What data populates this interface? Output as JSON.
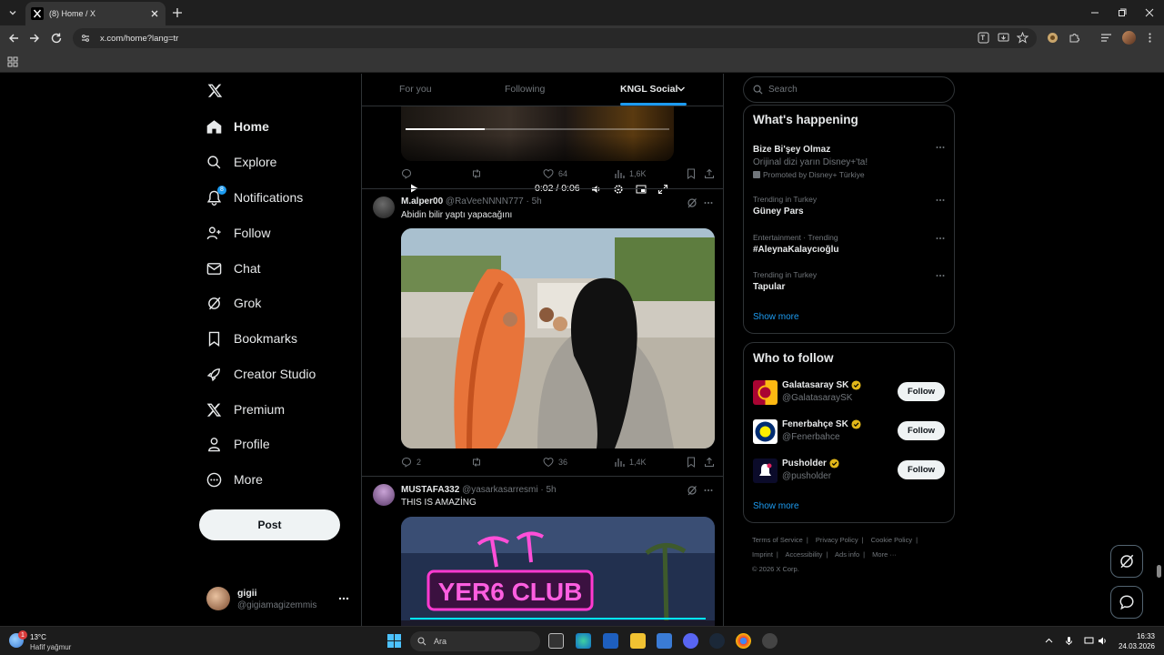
{
  "browser": {
    "tab_title": "(8) Home / X",
    "url": "x.com/home?lang=tr"
  },
  "nav": {
    "items": [
      {
        "label": "Home",
        "icon": "home-icon"
      },
      {
        "label": "Explore",
        "icon": "search-icon"
      },
      {
        "label": "Notifications",
        "icon": "bell-icon",
        "badge": "8"
      },
      {
        "label": "Follow",
        "icon": "person-plus-icon"
      },
      {
        "label": "Chat",
        "icon": "envelope-icon"
      },
      {
        "label": "Grok",
        "icon": "grok-icon"
      },
      {
        "label": "Bookmarks",
        "icon": "bookmark-icon"
      },
      {
        "label": "Creator Studio",
        "icon": "rocket-icon"
      },
      {
        "label": "Premium",
        "icon": "x-icon"
      },
      {
        "label": "Profile",
        "icon": "person-icon"
      },
      {
        "label": "More",
        "icon": "more-circle-icon"
      }
    ],
    "post_label": "Post"
  },
  "account": {
    "name": "gigii",
    "handle": "@gigiamagizemmis"
  },
  "timeline": {
    "tabs": [
      "For you",
      "Following",
      "KNGL Social"
    ],
    "video": {
      "time": "0:02 / 0:06"
    },
    "prev_actions": {
      "likes": "64",
      "views": "1,6K"
    },
    "tweets": [
      {
        "name": "M.alper00",
        "handle": "@RaVeeNNNN777",
        "time": "5h",
        "text": "Abidin bilir yaptı yapacağını",
        "replies": "2",
        "likes": "36",
        "views": "1,4K"
      },
      {
        "name": "MUSTAFA332",
        "handle": "@yasarkasarresmi",
        "time": "5h",
        "text": "THIS IS AMAZİNG",
        "media_text": "YER6 CLUB"
      }
    ]
  },
  "right": {
    "search_placeholder": "Search",
    "happening_title": "What's happening",
    "trends": [
      {
        "name": "Bize Bi'şey Olmaz",
        "desc": "Orijinal dizi yarın Disney+'ta!",
        "promo": "Promoted by Disney+ Türkiye"
      },
      {
        "meta": "Trending in Turkey",
        "name": "Güney Pars"
      },
      {
        "meta": "Entertainment · Trending",
        "name": "#AleynaKalaycıoğlu"
      },
      {
        "meta": "Trending in Turkey",
        "name": "Tapular"
      }
    ],
    "show_more": "Show more",
    "wtf_title": "Who to follow",
    "follow_label": "Follow",
    "wtf": [
      {
        "name": "Galatasaray SK",
        "handle": "@GalatasaraySK",
        "color": "#a90432"
      },
      {
        "name": "Fenerbahçe SK",
        "handle": "@Fenerbahce",
        "color": "#002d72"
      },
      {
        "name": "Pusholder",
        "handle": "@pusholder",
        "color": "#0b0b2a"
      }
    ],
    "footer": {
      "line1": [
        "Terms of Service",
        "Privacy Policy",
        "Cookie Policy"
      ],
      "line2": [
        "Imprint",
        "Accessibility",
        "Ads info",
        "More ···"
      ],
      "copyright": "© 2026 X Corp."
    }
  },
  "taskbar": {
    "temp": "13°C",
    "condition": "Hafif yağmur",
    "weather_badge": "1",
    "search": "Ara",
    "time": "16:33",
    "date": "24.03.2026"
  },
  "colors": {
    "accent": "#1d9bf0",
    "verified": "#e2b719"
  }
}
